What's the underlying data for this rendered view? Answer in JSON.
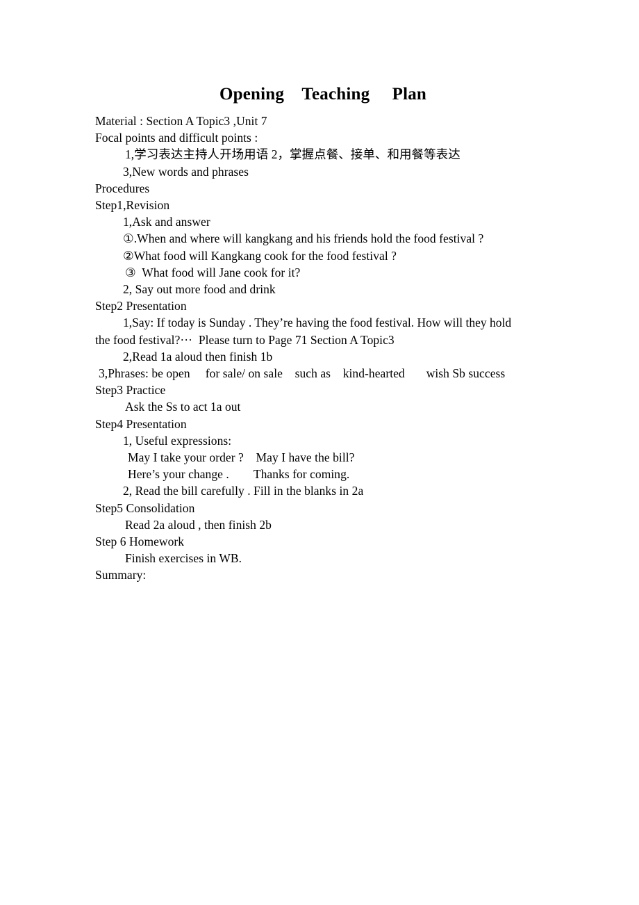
{
  "document": {
    "title": "Opening    Teaching     Plan",
    "lines": [
      {
        "id": "material",
        "text": "Material : Section A Topic3 ,Unit 7",
        "indent": "ind0"
      },
      {
        "id": "focal-points",
        "text": "Focal points and difficult points :",
        "indent": "ind0"
      },
      {
        "id": "focal-item-1-2",
        "text": "1,学习表达主持人开场用语 2，掌握点餐、接单、和用餐等表达",
        "indent": "ind4"
      },
      {
        "id": "focal-item-3",
        "text": "3,New words and phrases",
        "indent": "ind3"
      },
      {
        "id": "procedures",
        "text": "Procedures",
        "indent": "ind0"
      },
      {
        "id": "step1-heading",
        "text": "Step1,Revision",
        "indent": "ind0"
      },
      {
        "id": "step1-item-1",
        "text": "1,Ask and answer",
        "indent": "ind3"
      },
      {
        "id": "question-1",
        "text": "①.When and where will kangkang and his friends hold the food festival ?",
        "indent": "ind3"
      },
      {
        "id": "question-2",
        "text": "②What food will Kangkang cook for the food festival ?",
        "indent": "ind3"
      },
      {
        "id": "question-3",
        "text": "③  What food will Jane cook for it?",
        "indent": "ind4"
      },
      {
        "id": "step1-item-2",
        "text": "2, Say out more food and drink",
        "indent": "ind3"
      },
      {
        "id": "step2-heading",
        "text": "Step2 Presentation",
        "indent": "ind0"
      }
    ],
    "step2_paragraph": {
      "first_part": "1,Say: If today is Sunday . They’re having the food festival. How will they hold",
      "second_part": "the food festival?···  Please turn to Page 71 Section A Topic3"
    },
    "lines_after": [
      {
        "id": "step2-item-2",
        "text": "2,Read 1a aloud then finish 1b",
        "indent": "ind3"
      },
      {
        "id": "step2-item-3",
        "text": "3,Phrases: be open     for sale/ on sale    such as    kind-hearted       wish Sb success",
        "indent": "ind1"
      },
      {
        "id": "step3-heading",
        "text": "Step3 Practice",
        "indent": "ind0"
      },
      {
        "id": "step3-item-1",
        "text": "Ask the Ss to act 1a out",
        "indent": "ind4"
      },
      {
        "id": "step4-heading",
        "text": "Step4 Presentation",
        "indent": "ind0"
      },
      {
        "id": "step4-item-1",
        "text": "1, Useful expressions:",
        "indent": "ind3"
      },
      {
        "id": "expression-1",
        "text": "May I take your order ?    May I have the bill?",
        "indent": "ind5"
      },
      {
        "id": "expression-2",
        "text": "Here’s your change .        Thanks for coming.",
        "indent": "ind5"
      },
      {
        "id": "step4-item-2",
        "text": "2, Read the bill carefully . Fill in the blanks in 2a",
        "indent": "ind3"
      },
      {
        "id": "step5-heading",
        "text": "Step5 Consolidation",
        "indent": "ind0"
      },
      {
        "id": "step5-item-1",
        "text": "Read 2a aloud , then finish 2b",
        "indent": "ind4"
      },
      {
        "id": "step6-heading",
        "text": "Step 6 Homework",
        "indent": "ind0"
      },
      {
        "id": "step6-item-1",
        "text": "Finish exercises in WB.",
        "indent": "ind4"
      },
      {
        "id": "summary",
        "text": "Summary:",
        "indent": "ind0"
      }
    ]
  }
}
